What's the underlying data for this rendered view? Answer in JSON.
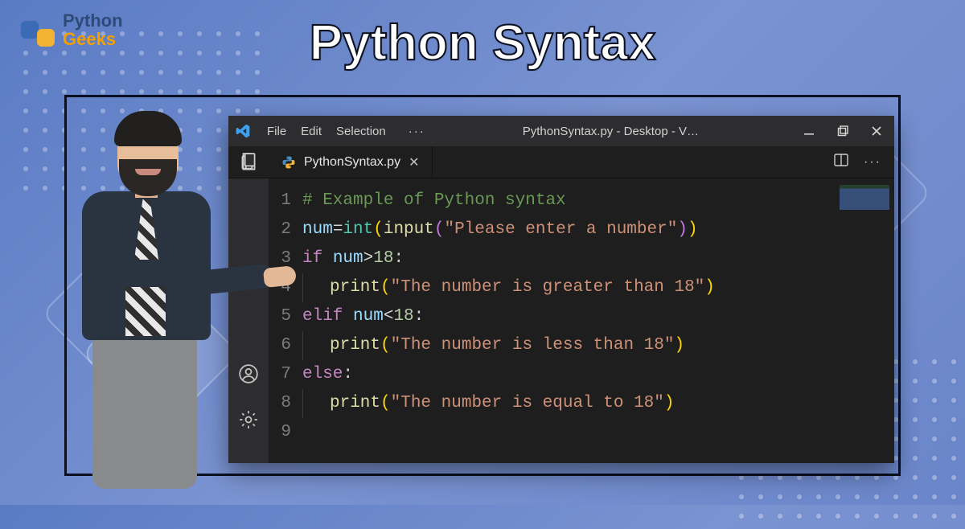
{
  "logo": {
    "line1": "Python",
    "line2": "Geeks"
  },
  "page_title": "Python Syntax",
  "vscode": {
    "menu": {
      "file": "File",
      "edit": "Edit",
      "selection": "Selection",
      "ellipsis": "···"
    },
    "window_title": "PythonSyntax.py - Desktop - V…",
    "tab": {
      "filename": "PythonSyntax.py"
    },
    "gutter": {
      "l1": "1",
      "l2": "2",
      "l3": "3",
      "l4": "4",
      "l5": "5",
      "l6": "6",
      "l7": "7",
      "l8": "8",
      "l9": "9"
    },
    "code": {
      "l1_comment": "# Example of Python syntax",
      "l2_var": "num",
      "l2_eq": "=",
      "l2_int": "int",
      "l2_p1o": "(",
      "l2_input": "input",
      "l2_p2o": "(",
      "l2_str": "\"Please enter a number\"",
      "l2_p2c": ")",
      "l2_p1c": ")",
      "l3_if": "if",
      "l3_space": " ",
      "l3_var": "num",
      "l3_op": ">",
      "l3_num": "18",
      "l3_colon": ":",
      "l4_print": "print",
      "l4_po": "(",
      "l4_str": "\"The number is greater than 18\"",
      "l4_pc": ")",
      "l5_elif": "elif",
      "l5_var": "num",
      "l5_op": "<",
      "l5_num": "18",
      "l5_colon": ":",
      "l6_print": "print",
      "l6_po": "(",
      "l6_str": "\"The number is less than 18\"",
      "l6_pc": ")",
      "l7_else": "else",
      "l7_colon": ":",
      "l8_print": "print",
      "l8_po": "(",
      "l8_str": "\"The number is equal to 18\"",
      "l8_pc": ")"
    }
  }
}
